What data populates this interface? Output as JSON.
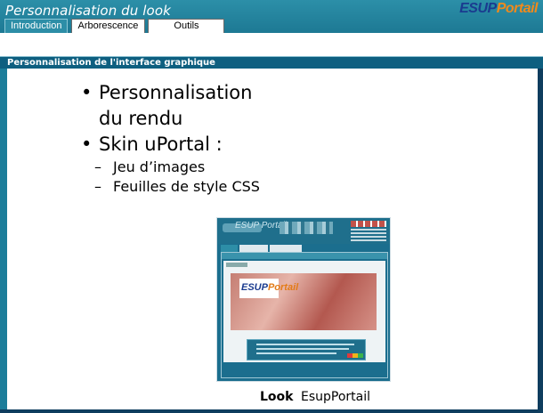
{
  "header": {
    "title": "Personnalisation du look",
    "brand_part1": "ESUP",
    "brand_part2": "Portail"
  },
  "tabs": [
    {
      "label": "Introduction",
      "active": true
    },
    {
      "label": "Arborescence",
      "active": false
    },
    {
      "label": "Outils",
      "active": false
    }
  ],
  "section": {
    "title": "Personnalisation de l'interface graphique"
  },
  "bullets": [
    {
      "text": "Personnalisation du rendu"
    },
    {
      "text": "Skin uPortal :"
    }
  ],
  "sub_bullets": [
    {
      "text": "Jeu d’images"
    },
    {
      "text": "Feuilles de style CSS"
    }
  ],
  "screenshot_thumb": {
    "brand": "ESUP Portail",
    "logo_part1": "ESUP",
    "logo_part2": "Portail"
  },
  "caption": {
    "look_label": "Look",
    "overlap_label": "EsupPortail"
  },
  "colors": {
    "header_teal": "#2c8fa8",
    "section_bar": "#0e5f80",
    "brand_blue": "#1a3b8f",
    "brand_orange": "#f08a1c"
  }
}
